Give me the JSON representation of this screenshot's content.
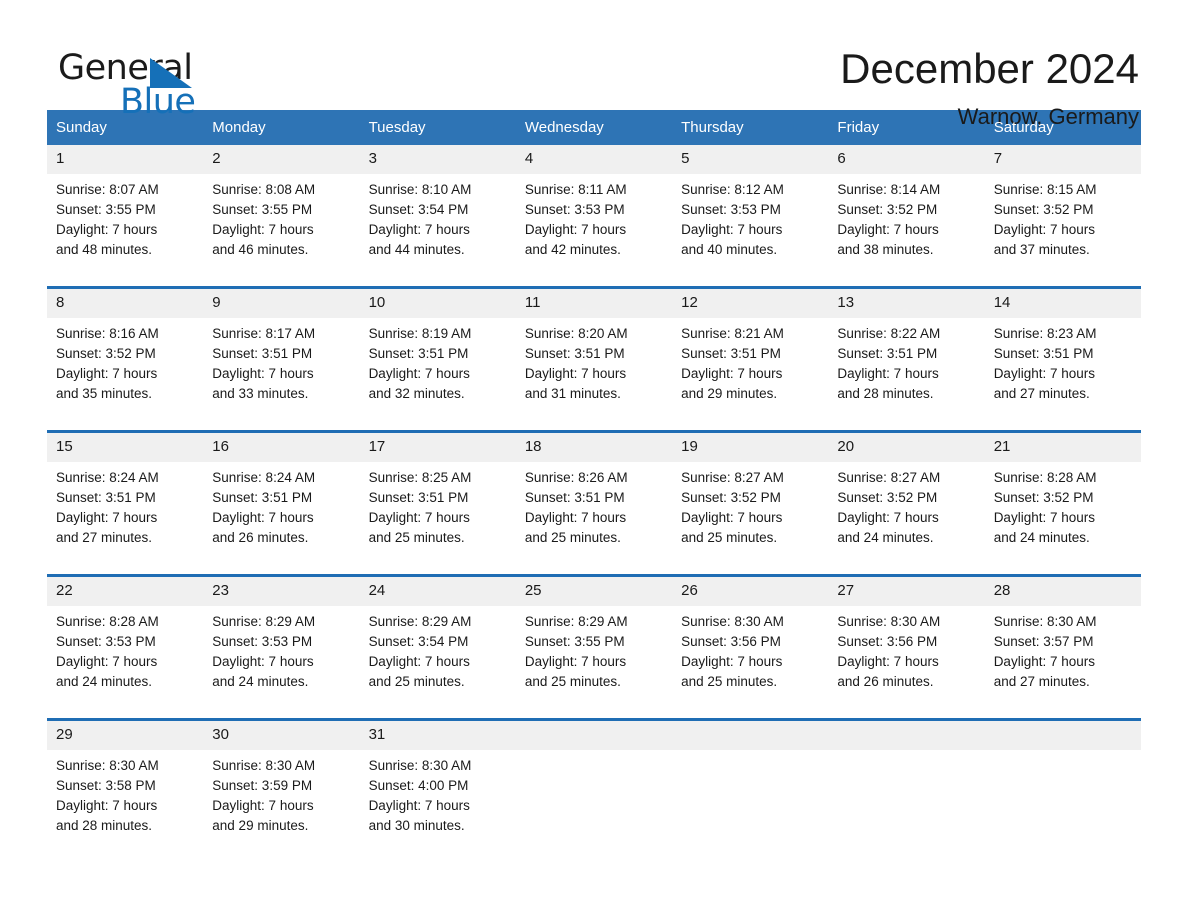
{
  "brand": {
    "name_part1": "General",
    "name_part2": "Blue",
    "logo_icon": "triangle-logo-icon",
    "accent_color": "#1570b8"
  },
  "header": {
    "title": "December 2024",
    "location": "Warnow, Germany"
  },
  "theme": {
    "header_blue": "#2e74b5",
    "separator_blue": "#1f6db4",
    "date_band_gray": "#f0f0f0"
  },
  "weekday_headers": [
    "Sunday",
    "Monday",
    "Tuesday",
    "Wednesday",
    "Thursday",
    "Friday",
    "Saturday"
  ],
  "weeks": [
    {
      "days": [
        {
          "date": "1",
          "sunrise": "Sunrise: 8:07 AM",
          "sunset": "Sunset: 3:55 PM",
          "daylight_line1": "Daylight: 7 hours",
          "daylight_line2": "and 48 minutes."
        },
        {
          "date": "2",
          "sunrise": "Sunrise: 8:08 AM",
          "sunset": "Sunset: 3:55 PM",
          "daylight_line1": "Daylight: 7 hours",
          "daylight_line2": "and 46 minutes."
        },
        {
          "date": "3",
          "sunrise": "Sunrise: 8:10 AM",
          "sunset": "Sunset: 3:54 PM",
          "daylight_line1": "Daylight: 7 hours",
          "daylight_line2": "and 44 minutes."
        },
        {
          "date": "4",
          "sunrise": "Sunrise: 8:11 AM",
          "sunset": "Sunset: 3:53 PM",
          "daylight_line1": "Daylight: 7 hours",
          "daylight_line2": "and 42 minutes."
        },
        {
          "date": "5",
          "sunrise": "Sunrise: 8:12 AM",
          "sunset": "Sunset: 3:53 PM",
          "daylight_line1": "Daylight: 7 hours",
          "daylight_line2": "and 40 minutes."
        },
        {
          "date": "6",
          "sunrise": "Sunrise: 8:14 AM",
          "sunset": "Sunset: 3:52 PM",
          "daylight_line1": "Daylight: 7 hours",
          "daylight_line2": "and 38 minutes."
        },
        {
          "date": "7",
          "sunrise": "Sunrise: 8:15 AM",
          "sunset": "Sunset: 3:52 PM",
          "daylight_line1": "Daylight: 7 hours",
          "daylight_line2": "and 37 minutes."
        }
      ]
    },
    {
      "days": [
        {
          "date": "8",
          "sunrise": "Sunrise: 8:16 AM",
          "sunset": "Sunset: 3:52 PM",
          "daylight_line1": "Daylight: 7 hours",
          "daylight_line2": "and 35 minutes."
        },
        {
          "date": "9",
          "sunrise": "Sunrise: 8:17 AM",
          "sunset": "Sunset: 3:51 PM",
          "daylight_line1": "Daylight: 7 hours",
          "daylight_line2": "and 33 minutes."
        },
        {
          "date": "10",
          "sunrise": "Sunrise: 8:19 AM",
          "sunset": "Sunset: 3:51 PM",
          "daylight_line1": "Daylight: 7 hours",
          "daylight_line2": "and 32 minutes."
        },
        {
          "date": "11",
          "sunrise": "Sunrise: 8:20 AM",
          "sunset": "Sunset: 3:51 PM",
          "daylight_line1": "Daylight: 7 hours",
          "daylight_line2": "and 31 minutes."
        },
        {
          "date": "12",
          "sunrise": "Sunrise: 8:21 AM",
          "sunset": "Sunset: 3:51 PM",
          "daylight_line1": "Daylight: 7 hours",
          "daylight_line2": "and 29 minutes."
        },
        {
          "date": "13",
          "sunrise": "Sunrise: 8:22 AM",
          "sunset": "Sunset: 3:51 PM",
          "daylight_line1": "Daylight: 7 hours",
          "daylight_line2": "and 28 minutes."
        },
        {
          "date": "14",
          "sunrise": "Sunrise: 8:23 AM",
          "sunset": "Sunset: 3:51 PM",
          "daylight_line1": "Daylight: 7 hours",
          "daylight_line2": "and 27 minutes."
        }
      ]
    },
    {
      "days": [
        {
          "date": "15",
          "sunrise": "Sunrise: 8:24 AM",
          "sunset": "Sunset: 3:51 PM",
          "daylight_line1": "Daylight: 7 hours",
          "daylight_line2": "and 27 minutes."
        },
        {
          "date": "16",
          "sunrise": "Sunrise: 8:24 AM",
          "sunset": "Sunset: 3:51 PM",
          "daylight_line1": "Daylight: 7 hours",
          "daylight_line2": "and 26 minutes."
        },
        {
          "date": "17",
          "sunrise": "Sunrise: 8:25 AM",
          "sunset": "Sunset: 3:51 PM",
          "daylight_line1": "Daylight: 7 hours",
          "daylight_line2": "and 25 minutes."
        },
        {
          "date": "18",
          "sunrise": "Sunrise: 8:26 AM",
          "sunset": "Sunset: 3:51 PM",
          "daylight_line1": "Daylight: 7 hours",
          "daylight_line2": "and 25 minutes."
        },
        {
          "date": "19",
          "sunrise": "Sunrise: 8:27 AM",
          "sunset": "Sunset: 3:52 PM",
          "daylight_line1": "Daylight: 7 hours",
          "daylight_line2": "and 25 minutes."
        },
        {
          "date": "20",
          "sunrise": "Sunrise: 8:27 AM",
          "sunset": "Sunset: 3:52 PM",
          "daylight_line1": "Daylight: 7 hours",
          "daylight_line2": "and 24 minutes."
        },
        {
          "date": "21",
          "sunrise": "Sunrise: 8:28 AM",
          "sunset": "Sunset: 3:52 PM",
          "daylight_line1": "Daylight: 7 hours",
          "daylight_line2": "and 24 minutes."
        }
      ]
    },
    {
      "days": [
        {
          "date": "22",
          "sunrise": "Sunrise: 8:28 AM",
          "sunset": "Sunset: 3:53 PM",
          "daylight_line1": "Daylight: 7 hours",
          "daylight_line2": "and 24 minutes."
        },
        {
          "date": "23",
          "sunrise": "Sunrise: 8:29 AM",
          "sunset": "Sunset: 3:53 PM",
          "daylight_line1": "Daylight: 7 hours",
          "daylight_line2": "and 24 minutes."
        },
        {
          "date": "24",
          "sunrise": "Sunrise: 8:29 AM",
          "sunset": "Sunset: 3:54 PM",
          "daylight_line1": "Daylight: 7 hours",
          "daylight_line2": "and 25 minutes."
        },
        {
          "date": "25",
          "sunrise": "Sunrise: 8:29 AM",
          "sunset": "Sunset: 3:55 PM",
          "daylight_line1": "Daylight: 7 hours",
          "daylight_line2": "and 25 minutes."
        },
        {
          "date": "26",
          "sunrise": "Sunrise: 8:30 AM",
          "sunset": "Sunset: 3:56 PM",
          "daylight_line1": "Daylight: 7 hours",
          "daylight_line2": "and 25 minutes."
        },
        {
          "date": "27",
          "sunrise": "Sunrise: 8:30 AM",
          "sunset": "Sunset: 3:56 PM",
          "daylight_line1": "Daylight: 7 hours",
          "daylight_line2": "and 26 minutes."
        },
        {
          "date": "28",
          "sunrise": "Sunrise: 8:30 AM",
          "sunset": "Sunset: 3:57 PM",
          "daylight_line1": "Daylight: 7 hours",
          "daylight_line2": "and 27 minutes."
        }
      ]
    },
    {
      "days": [
        {
          "date": "29",
          "sunrise": "Sunrise: 8:30 AM",
          "sunset": "Sunset: 3:58 PM",
          "daylight_line1": "Daylight: 7 hours",
          "daylight_line2": "and 28 minutes."
        },
        {
          "date": "30",
          "sunrise": "Sunrise: 8:30 AM",
          "sunset": "Sunset: 3:59 PM",
          "daylight_line1": "Daylight: 7 hours",
          "daylight_line2": "and 29 minutes."
        },
        {
          "date": "31",
          "sunrise": "Sunrise: 8:30 AM",
          "sunset": "Sunset: 4:00 PM",
          "daylight_line1": "Daylight: 7 hours",
          "daylight_line2": "and 30 minutes."
        },
        {
          "date": "",
          "sunrise": "",
          "sunset": "",
          "daylight_line1": "",
          "daylight_line2": ""
        },
        {
          "date": "",
          "sunrise": "",
          "sunset": "",
          "daylight_line1": "",
          "daylight_line2": ""
        },
        {
          "date": "",
          "sunrise": "",
          "sunset": "",
          "daylight_line1": "",
          "daylight_line2": ""
        },
        {
          "date": "",
          "sunrise": "",
          "sunset": "",
          "daylight_line1": "",
          "daylight_line2": ""
        }
      ]
    }
  ]
}
